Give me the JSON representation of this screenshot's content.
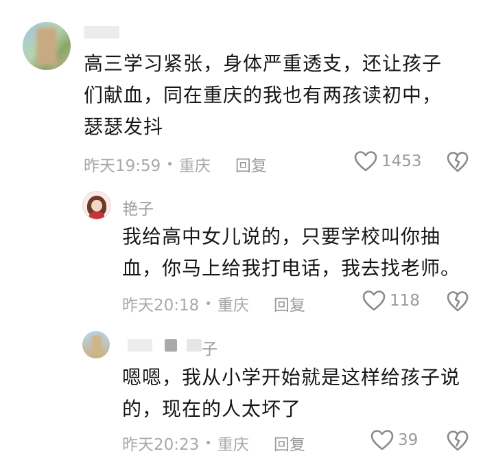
{
  "comments": [
    {
      "text_lines": [
        "高三学习紧张，身体严重透支，还让孩子",
        "们献血，同在重庆的我也有两孩读初中，",
        "瑟瑟发抖"
      ],
      "time": "昨天19:59",
      "location": "重庆",
      "reply_label": "回复",
      "likes": "1453"
    },
    {
      "author": "艳子",
      "text_lines": [
        "我给高中女儿说的，只要学校叫你抽",
        "血，你马上给我打电话，我去找老师。"
      ],
      "time": "昨天20:18",
      "location": "重庆",
      "reply_label": "回复",
      "likes": "118"
    },
    {
      "author_partial": "子",
      "text_lines": [
        "嗯嗯，我从小学开始就是这样给孩子说",
        "的，现在的人太坏了"
      ],
      "time": "昨天20:23",
      "location": "重庆",
      "reply_label": "回复",
      "likes": "39"
    }
  ],
  "icons": {
    "like": "heart-outline-icon",
    "dislike": "broken-heart-icon"
  },
  "colors": {
    "text": "#161616",
    "meta": "#a8a8a8",
    "icon": "#8a8a8a"
  }
}
